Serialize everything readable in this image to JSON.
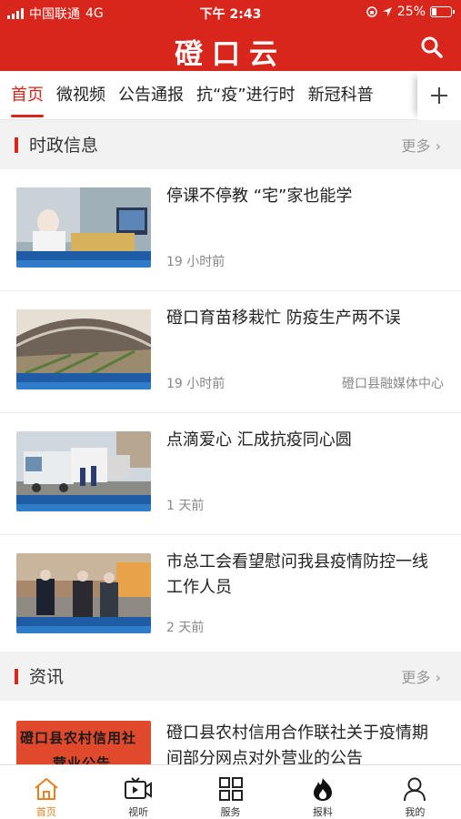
{
  "status_bar": {
    "carrier": "中国联通",
    "network": "4G",
    "time": "下午 2:43",
    "battery": "25%",
    "battery_level": 0.25
  },
  "header": {
    "title": "磴口云",
    "search_icon": "search-icon"
  },
  "tabs": {
    "items": [
      "首页",
      "微视频",
      "公告通报",
      "抗“疫”进行时",
      "新冠科普"
    ],
    "active_index": 0,
    "add_icon": "plus-icon"
  },
  "sections": [
    {
      "title": "时政信息",
      "more": "更多"
    },
    {
      "title": "资讯",
      "more": "更多"
    }
  ],
  "news": [
    {
      "title": "停课不停教 “宅”家也能学",
      "time": "19 小时前",
      "source": ""
    },
    {
      "title": "磴口育苗移栽忙 防疫生产两不误",
      "time": "19 小时前",
      "source": "磴口县融媒体中心"
    },
    {
      "title": "点滴爱心 汇成抗疫同心圆",
      "time": "1 天前",
      "source": ""
    },
    {
      "title": "市总工会看望慰问我县疫情防控一线工作人员",
      "time": "2 天前",
      "source": ""
    },
    {
      "title": "磴口县农村信用合作联社关于疫情期间部分网点对外营业的公告",
      "time": "",
      "source": "",
      "thumb_text": "磴口县农村信用社",
      "thumb_text2": "营业公告"
    }
  ],
  "tabbar": {
    "items": [
      {
        "label": "首页",
        "icon": "home-icon"
      },
      {
        "label": "视听",
        "icon": "video-icon"
      },
      {
        "label": "服务",
        "icon": "grid-icon"
      },
      {
        "label": "报料",
        "icon": "fire-icon"
      },
      {
        "label": "我的",
        "icon": "user-icon"
      }
    ],
    "active_index": 0
  },
  "colors": {
    "brand_red": "#d9261c",
    "active_tab_orange": "#e8801e",
    "section_bg": "#f2f2f2"
  }
}
